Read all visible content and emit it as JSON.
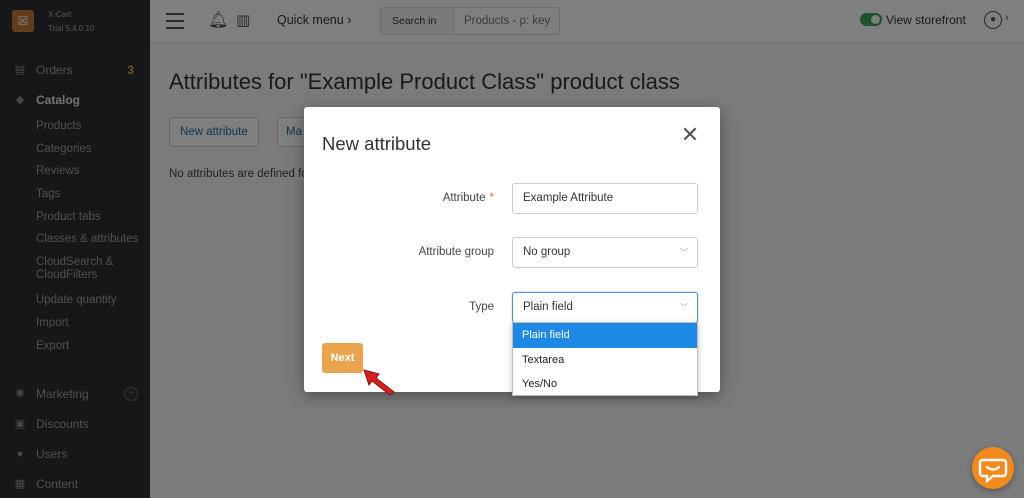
{
  "brand": {
    "name": "X-Cart",
    "version": "Trial 5.4.0.10"
  },
  "sidebar": {
    "orders": {
      "label": "Orders",
      "count": "3"
    },
    "catalog": {
      "label": "Catalog",
      "items": [
        "Products",
        "Categories",
        "Reviews",
        "Tags",
        "Product tabs",
        "Classes & attributes",
        "CloudSearch & CloudFilters",
        "Update quantity",
        "Import",
        "Export"
      ]
    },
    "marketing": "Marketing",
    "discounts": "Discounts",
    "users": "Users",
    "content": "Content"
  },
  "topbar": {
    "quick_menu": "Quick menu",
    "search_in": "Search in",
    "search_placeholder": "Products - p: key",
    "view_storefront": "View storefront"
  },
  "main": {
    "title": "Attributes for \"Example Product Class\" product class",
    "new_attribute_button": "New attribute",
    "manage_button_partial": "Ma",
    "empty_message": "No attributes are defined fo"
  },
  "modal": {
    "title": "New attribute",
    "attribute_label": "Attribute",
    "required_mark": "*",
    "attribute_value": "Example Attribute",
    "group_label": "Attribute group",
    "group_value": "No group",
    "type_label": "Type",
    "type_value": "Plain field",
    "type_options": [
      "Plain field",
      "Textarea",
      "Yes/No"
    ],
    "next_button": "Next"
  },
  "colors": {
    "accent": "#e9a44d",
    "selected_option": "#1e88e5",
    "chat": "#f28a1e",
    "toggle_on": "#3aa655",
    "annotation_arrow": "#d42020"
  }
}
